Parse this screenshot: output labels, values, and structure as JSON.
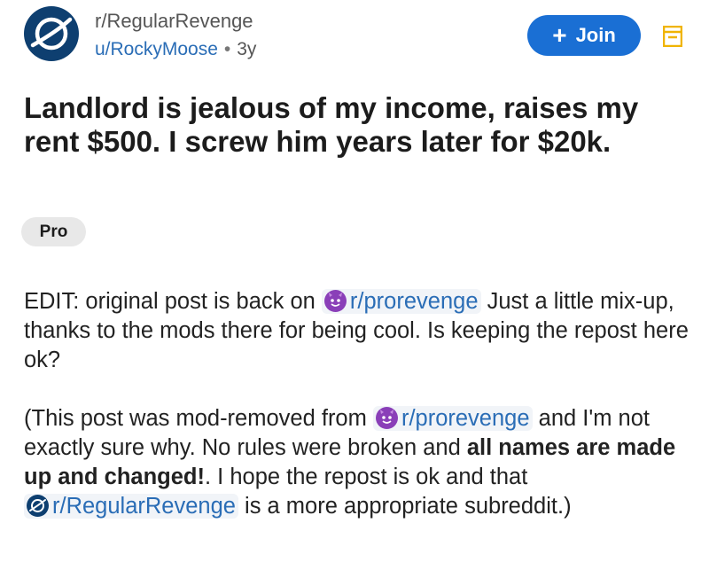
{
  "post": {
    "subreddit": "r/RegularRevenge",
    "author": "u/RockyMoose",
    "separator": "•",
    "age": "3y",
    "join_label": "Join",
    "join_plus": "+",
    "title": "Landlord is jealous of my income, raises my rent $500. I screw him years later for $20k.",
    "flair": "Pro"
  },
  "body": {
    "p1_a": "EDIT: original post is back on ",
    "p1_link": "r/prorevenge",
    "p1_b": " Just a little mix-up, thanks to the mods there for being cool. Is keeping the repost here ok?",
    "p2_a": "(This post was mod-removed from ",
    "p2_link1": "r/prorevenge",
    "p2_b": " and I'm not exactly sure why. No rules were broken and ",
    "p2_bold": "all names are made up and changed!",
    "p2_c": ". I hope the repost is ok and that ",
    "p2_link2": "r/RegularRevenge",
    "p2_d": " is a more appropriate subreddit.)"
  },
  "icons": {
    "subreddit_avatar": "planet-logo-icon",
    "menu": "menu-icon",
    "prorevenge": "devil-face-emoji-icon"
  },
  "colors": {
    "join_button": "#1a6fd4",
    "link": "#2a6db6",
    "avatar_bg": "#0e3f70",
    "menu_icon": "#f0b400"
  }
}
